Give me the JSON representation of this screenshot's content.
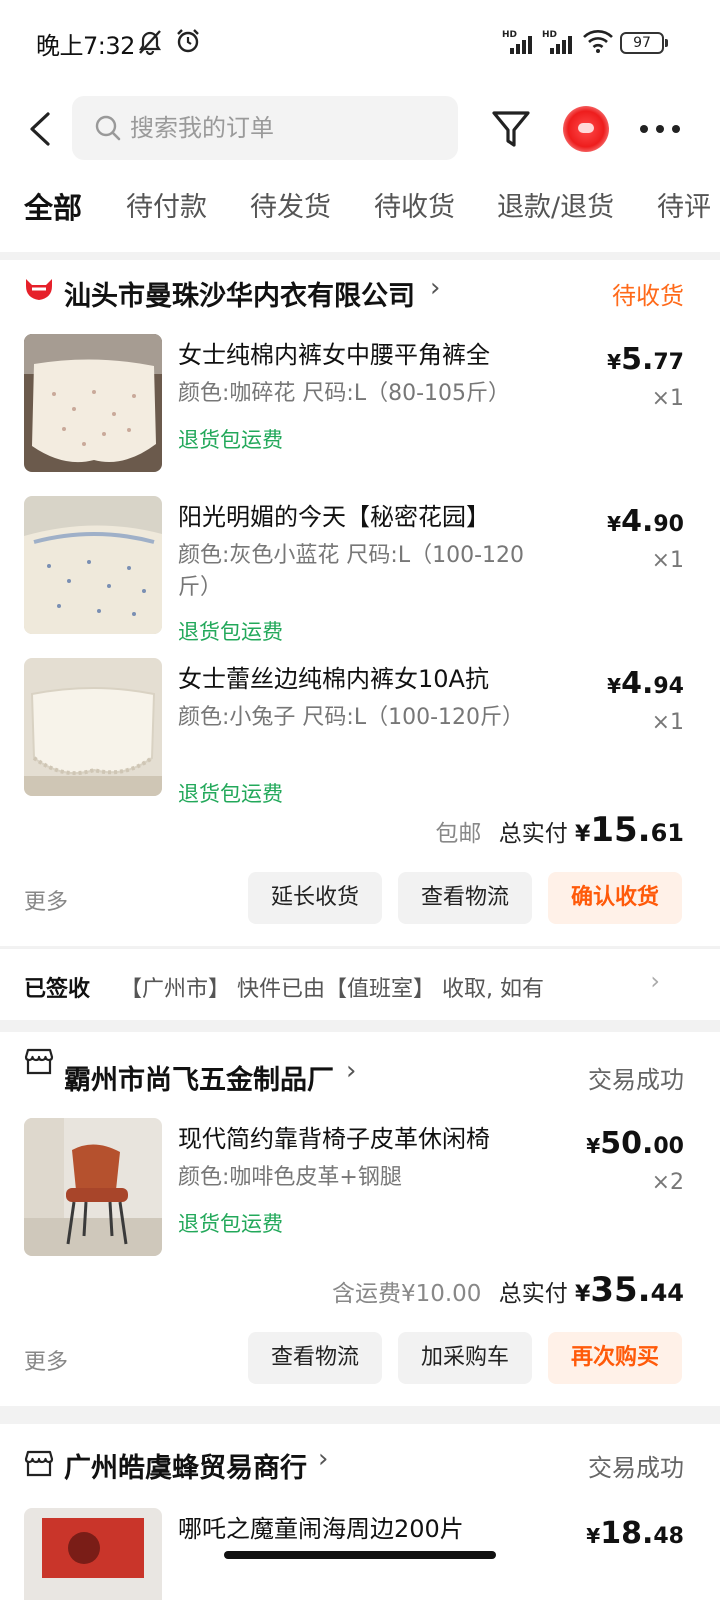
{
  "status_bar": {
    "time": "晚上7:32",
    "signal_label": "HD",
    "battery": "97",
    "icons": [
      "mute-icon",
      "alarm-icon",
      "signal-icon",
      "wifi-icon",
      "battery-icon"
    ]
  },
  "search": {
    "placeholder": "搜索我的订单"
  },
  "tabs": [
    "全部",
    "待付款",
    "待发货",
    "待收货",
    "退款/退货",
    "待评"
  ],
  "orders": [
    {
      "shop": "汕头市曼珠沙华内衣有限公司",
      "shop_icon": "tmall-cat-icon",
      "status": "待收货",
      "items": [
        {
          "title": "女士纯棉内裤女中腰平角裤全",
          "spec": "颜色:咖碎花 尺码:L（80-105斤）",
          "tag": "退货包运费",
          "price_cur": "¥",
          "price_int": "5.",
          "price_dec": "77",
          "qty": "×1"
        },
        {
          "title": "阳光明媚的今天【秘密花园】",
          "spec": "颜色:灰色小蓝花 尺码:L（100-120斤）",
          "tag": "退货包运费",
          "price_cur": "¥",
          "price_int": "4.",
          "price_dec": "90",
          "qty": "×1"
        },
        {
          "title": "女士蕾丝边纯棉内裤女10A抗",
          "spec": "颜色:小兔子 尺码:L（100-120斤）",
          "tag": "退货包运费",
          "price_cur": "¥",
          "price_int": "4.",
          "price_dec": "94",
          "qty": "×1"
        }
      ],
      "shipping_note": "包邮",
      "total_label": "总实付",
      "total_cur": "¥",
      "total_int": "15.",
      "total_dec": "61",
      "more": "更多",
      "buttons": [
        "延长收货",
        "查看物流",
        "确认收货"
      ],
      "logistics": {
        "label": "已签收",
        "text": "【广州市】 快件已由【值班室】 收取, 如有"
      }
    },
    {
      "shop": "霸州市尚飞五金制品厂",
      "shop_icon": "store-icon",
      "status": "交易成功",
      "items": [
        {
          "title": "现代简约靠背椅子皮革休闲椅",
          "spec": "颜色:咖啡色皮革+钢腿",
          "tag": "退货包运费",
          "price_cur": "¥",
          "price_int": "50.",
          "price_dec": "00",
          "qty": "×2"
        }
      ],
      "shipping_note": "含运费¥10.00",
      "total_label": "总实付",
      "total_cur": "¥",
      "total_int": "35.",
      "total_dec": "44",
      "more": "更多",
      "buttons": [
        "查看物流",
        "加采购车",
        "再次购买"
      ]
    },
    {
      "shop": "广州皓虞蜂贸易商行",
      "shop_icon": "store-icon",
      "status": "交易成功",
      "items": [
        {
          "title": "哪吒之魔童闹海周边200片",
          "price_cur": "¥",
          "price_int": "18.",
          "price_dec": "48"
        }
      ]
    }
  ]
}
